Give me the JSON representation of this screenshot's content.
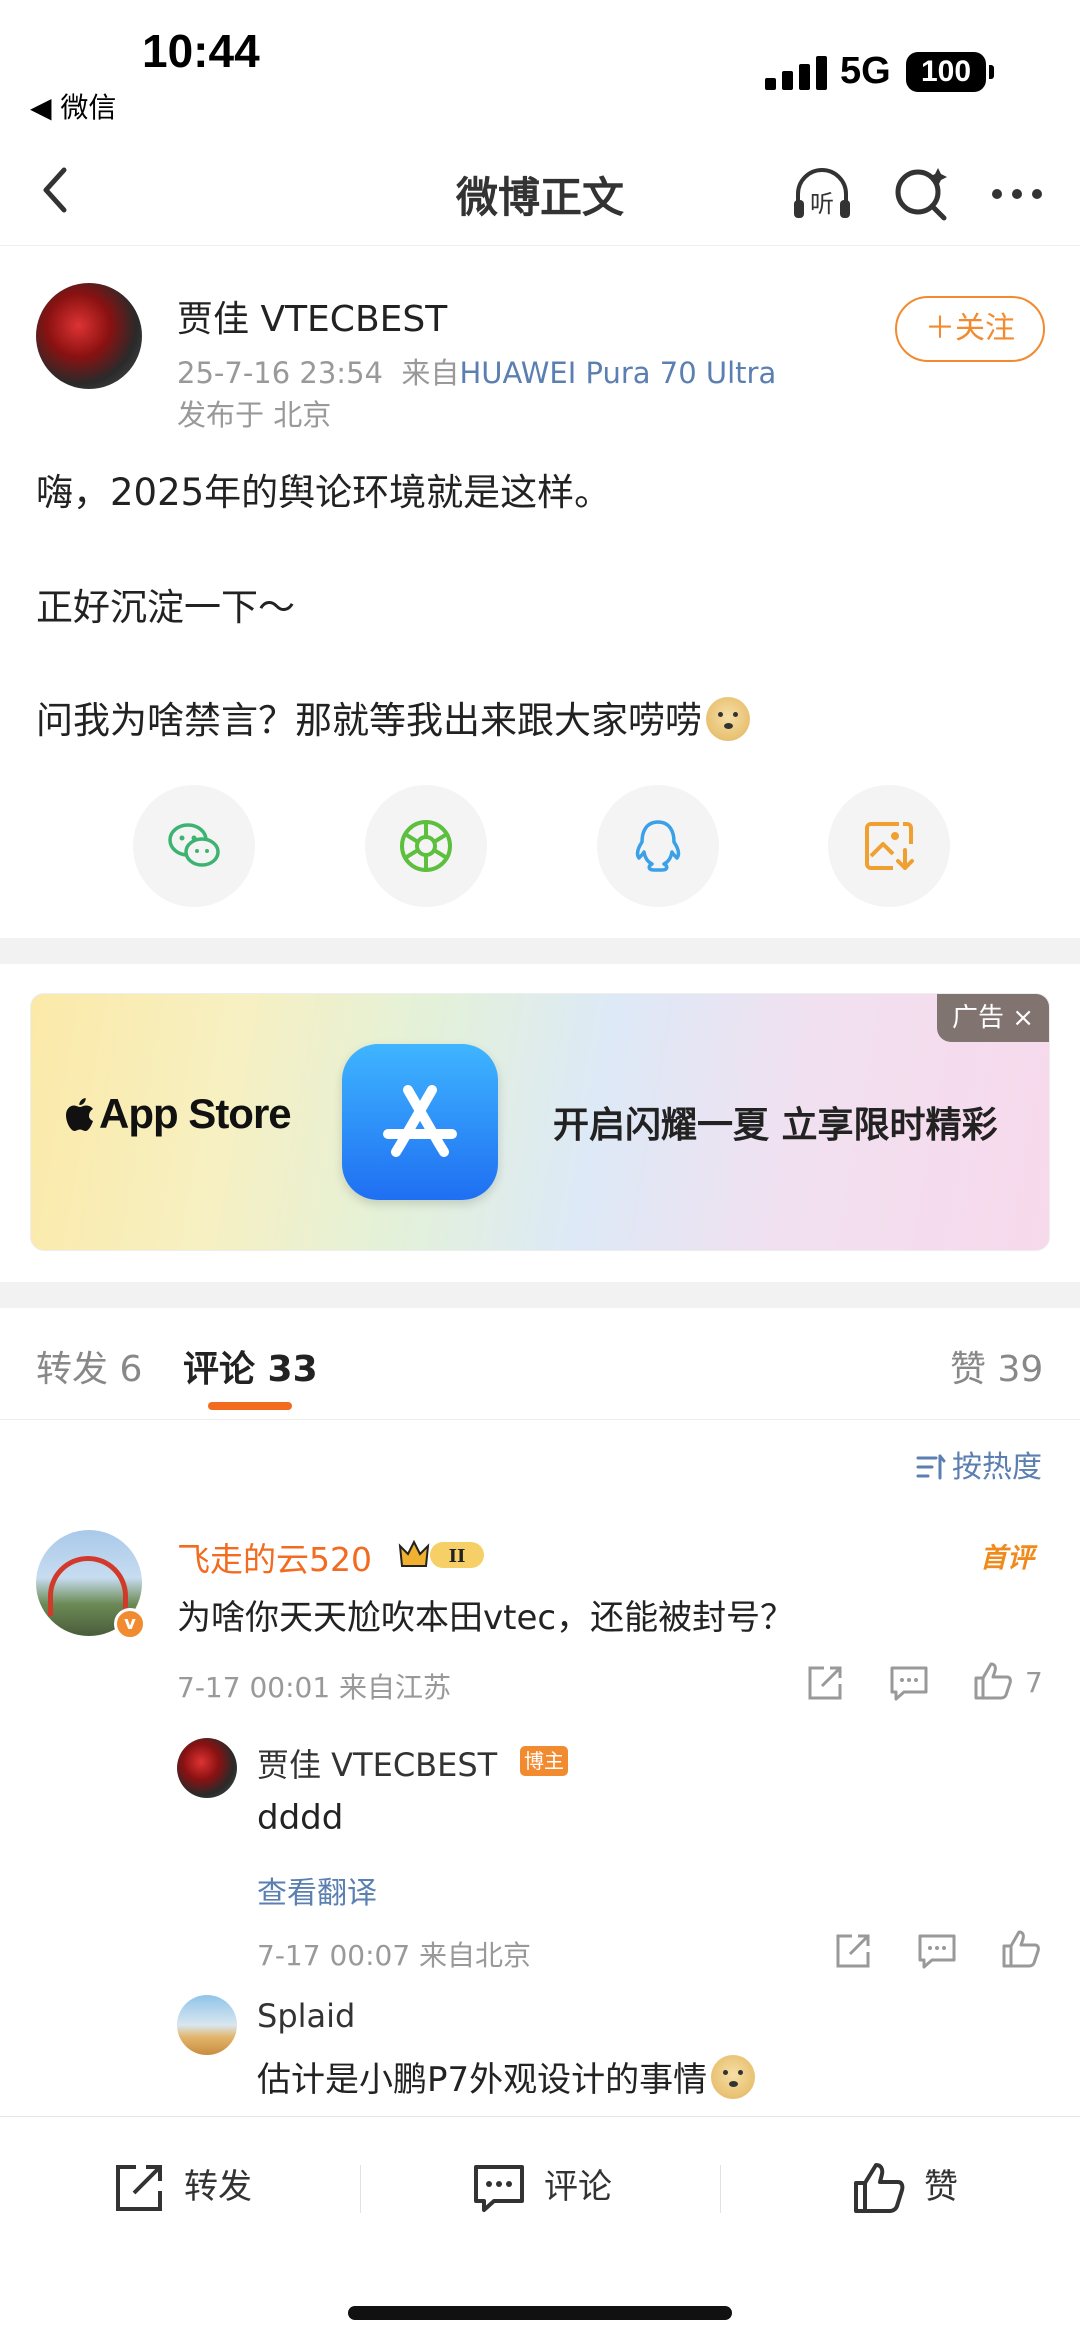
{
  "status_bar": {
    "time": "10:44",
    "back_app": "◀ 微信",
    "network": "5G",
    "battery": "100"
  },
  "nav": {
    "title": "微博正文",
    "icons": [
      "back-arrow-icon",
      "listen-icon",
      "search-icon",
      "more-icon"
    ],
    "listen_label": "听"
  },
  "post": {
    "author": "贾佳 VTECBEST",
    "time": "25-7-16 23:54",
    "from_prefix": "来自",
    "device": "HUAWEI Pura 70 Ultra",
    "location": "发布于 北京",
    "follow_label": "＋关注",
    "lines": [
      "嗨，2025年的舆论环境就是这样。",
      "正好沉淀一下～",
      "问我为啥禁言？那就等我出来跟大家唠唠"
    ],
    "share_icons": [
      "wechat-icon",
      "moments-icon",
      "qq-icon",
      "save-image-icon"
    ]
  },
  "ad": {
    "tag": "广告 ×",
    "brand": "App Store",
    "slogan": "开启闪耀一夏 立享限时精彩"
  },
  "tabs": {
    "repost": "转发 6",
    "comment": "评论 33",
    "like": "赞 39"
  },
  "sort_label": "按热度",
  "comments": [
    {
      "name": "飞走的云520",
      "vip_level": "II",
      "tag": "首评",
      "text": "为啥你天天尬吹本田vtec，还能被封号？",
      "meta": "7-17 00:01 来自江苏",
      "likes": "7",
      "replies": [
        {
          "name": "贾佳 VTECBEST",
          "author_tag": "博主",
          "text": "dddd",
          "translate": "查看翻译",
          "meta": "7-17 00:07 来自北京"
        },
        {
          "name": "Splaid",
          "text": "估计是小鹏P7外观设计的事情"
        }
      ]
    }
  ],
  "bottom_bar": {
    "repost": "转发",
    "comment": "评论",
    "like": "赞"
  },
  "colors": {
    "accent": "#f26b1f",
    "link": "#5b7fb0",
    "muted": "#999999"
  }
}
